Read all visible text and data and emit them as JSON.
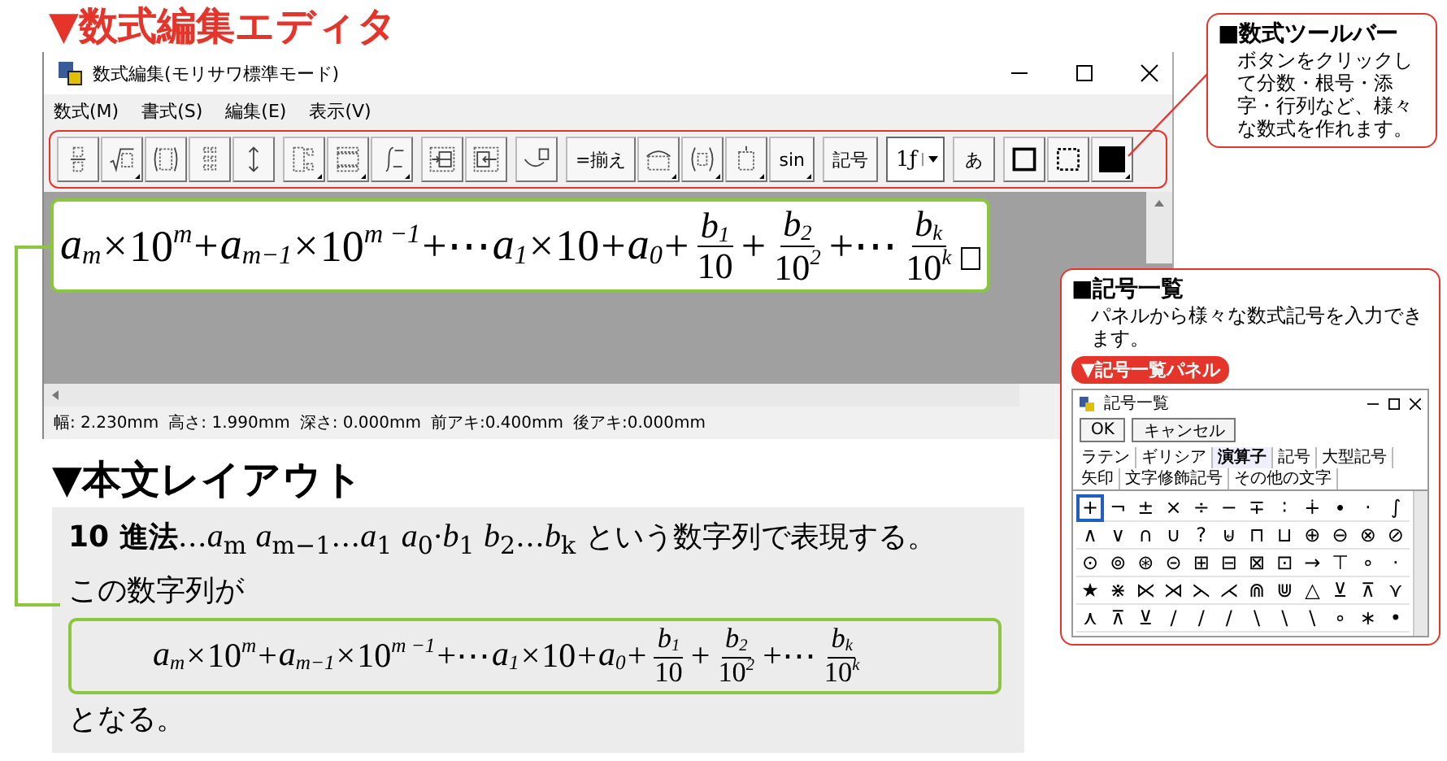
{
  "heading": "▼数式編集エディタ",
  "window": {
    "title": "数式編集(モリサワ標準モード)",
    "menu": [
      "数式(M)",
      "書式(S)",
      "編集(E)",
      "表示(V)"
    ],
    "toolbar": [
      [
        {
          "kind": "icon",
          "menu": false
        },
        {
          "kind": "icon",
          "menu": true
        },
        {
          "kind": "icon",
          "menu": false
        },
        {
          "kind": "icon",
          "menu": false
        },
        {
          "kind": "icon",
          "menu": false
        }
      ],
      [
        {
          "kind": "icon",
          "menu": true
        },
        {
          "kind": "icon",
          "menu": true
        },
        {
          "kind": "icon",
          "menu": true
        }
      ],
      [
        {
          "kind": "icon",
          "menu": false
        },
        {
          "kind": "icon",
          "menu": false
        }
      ],
      [
        {
          "kind": "icon",
          "menu": false
        }
      ],
      [
        {
          "kind": "label",
          "text": "=揃え",
          "menu": false
        },
        {
          "kind": "icon",
          "menu": true
        },
        {
          "kind": "icon",
          "menu": true
        },
        {
          "kind": "icon",
          "menu": true
        },
        {
          "kind": "label",
          "text": "sin",
          "menu": true
        }
      ],
      [
        {
          "kind": "label",
          "text": "記号",
          "menu": false
        }
      ],
      [
        {
          "kind": "dropdown",
          "text": "1ƒ"
        }
      ],
      [
        {
          "kind": "label",
          "text": "あ",
          "menu": false
        }
      ],
      [
        {
          "kind": "icon",
          "menu": false
        },
        {
          "kind": "icon",
          "menu": false
        },
        {
          "kind": "swatch",
          "menu": true
        }
      ]
    ],
    "formula": [
      {
        "kind": "var",
        "base": "a",
        "sub": "m"
      },
      {
        "kind": "op",
        "text": "×"
      },
      {
        "kind": "num",
        "base": "10",
        "sup": "m"
      },
      {
        "kind": "op",
        "text": "+"
      },
      {
        "kind": "var",
        "base": "a",
        "sub": "m−1"
      },
      {
        "kind": "op",
        "text": "×"
      },
      {
        "kind": "num",
        "base": "10",
        "sup": "m −1"
      },
      {
        "kind": "op",
        "text": "+⋯"
      },
      {
        "kind": "var",
        "base": "a",
        "sub": "1"
      },
      {
        "kind": "op",
        "text": "×"
      },
      {
        "kind": "num",
        "base": "10"
      },
      {
        "kind": "op",
        "text": "+"
      },
      {
        "kind": "var",
        "base": "a",
        "sub": "0"
      },
      {
        "kind": "op",
        "text": "+"
      },
      {
        "kind": "frac",
        "num": {
          "kind": "var",
          "base": "b",
          "sub": "1"
        },
        "den": {
          "kind": "num",
          "base": "10"
        }
      },
      {
        "kind": "op",
        "text": "+"
      },
      {
        "kind": "frac",
        "num": {
          "kind": "var",
          "base": "b",
          "sub": "2"
        },
        "den": {
          "kind": "num",
          "base": "10",
          "sup": "2"
        }
      },
      {
        "kind": "op",
        "text": "+⋯"
      },
      {
        "kind": "frac",
        "num": {
          "kind": "var",
          "base": "b",
          "sub": "k"
        },
        "den": {
          "kind": "num",
          "base": "10",
          "sup": "k"
        }
      }
    ],
    "status_bar": [
      "幅: 2.230mm",
      "高さ: 1.990mm",
      "深さ: 0.000mm",
      "前アキ:0.400mm",
      "後アキ:0.000mm"
    ]
  },
  "toolbar_note": {
    "title": "■数式ツールバー",
    "text": "ボタンをクリックして分数・根号・添字・行列など、様々な数式を作れます。"
  },
  "symbol_note": {
    "title": "■記号一覧",
    "text": "パネルから様々な数式記号を入力できます。",
    "badge": "▼記号一覧パネル",
    "panel": {
      "title": "記号一覧",
      "buttons": [
        "OK",
        "キャンセル"
      ],
      "tabs": [
        {
          "label": "ラテン",
          "selected": false
        },
        {
          "label": "ギリシア",
          "selected": false
        },
        {
          "label": "演算子",
          "selected": true
        },
        {
          "label": "記号",
          "selected": false
        },
        {
          "label": "大型記号",
          "selected": false
        },
        {
          "label": "矢印",
          "selected": false
        },
        {
          "label": "文字修飾記号",
          "selected": false
        },
        {
          "label": "その他の文字",
          "selected": false
        }
      ],
      "symbols": [
        {
          "text": "+",
          "selected": true
        },
        {
          "text": "¬",
          "selected": false
        },
        {
          "text": "±",
          "selected": false
        },
        {
          "text": "×",
          "selected": false
        },
        {
          "text": "÷",
          "selected": false
        },
        {
          "text": "−",
          "selected": false
        },
        {
          "text": "∓",
          "selected": false
        },
        {
          "text": "∶",
          "selected": false
        },
        {
          "text": "∔",
          "selected": false
        },
        {
          "text": "∙",
          "selected": false
        },
        {
          "text": "·",
          "selected": false
        },
        {
          "text": "∫",
          "selected": false
        },
        {
          "text": "∧",
          "selected": false
        },
        {
          "text": "∨",
          "selected": false
        },
        {
          "text": "∩",
          "selected": false
        },
        {
          "text": "∪",
          "selected": false
        },
        {
          "text": "?",
          "selected": false
        },
        {
          "text": "⊌",
          "selected": false
        },
        {
          "text": "⊓",
          "selected": false
        },
        {
          "text": "⊔",
          "selected": false
        },
        {
          "text": "⊕",
          "selected": false
        },
        {
          "text": "⊖",
          "selected": false
        },
        {
          "text": "⊗",
          "selected": false
        },
        {
          "text": "⊘",
          "selected": false
        },
        {
          "text": "⊙",
          "selected": false
        },
        {
          "text": "⊚",
          "selected": false
        },
        {
          "text": "⊛",
          "selected": false
        },
        {
          "text": "⊝",
          "selected": false
        },
        {
          "text": "⊞",
          "selected": false
        },
        {
          "text": "⊟",
          "selected": false
        },
        {
          "text": "⊠",
          "selected": false
        },
        {
          "text": "⊡",
          "selected": false
        },
        {
          "text": "→",
          "selected": false
        },
        {
          "text": "⊤",
          "selected": false
        },
        {
          "text": "∘",
          "selected": false
        },
        {
          "text": "·",
          "selected": false
        },
        {
          "text": "★",
          "selected": false
        },
        {
          "text": "⋇",
          "selected": false
        },
        {
          "text": "⋉",
          "selected": false
        },
        {
          "text": "⋊",
          "selected": false
        },
        {
          "text": "⋋",
          "selected": false
        },
        {
          "text": "⋌",
          "selected": false
        },
        {
          "text": "⋒",
          "selected": false
        },
        {
          "text": "⋓",
          "selected": false
        },
        {
          "text": "△",
          "selected": false
        },
        {
          "text": "⊻",
          "selected": false
        },
        {
          "text": "⊼",
          "selected": false
        },
        {
          "text": "⋎",
          "selected": false
        },
        {
          "text": "⋏",
          "selected": false
        },
        {
          "text": "⊼",
          "selected": false
        },
        {
          "text": "⊻",
          "selected": false
        },
        {
          "text": "/",
          "selected": false
        },
        {
          "text": "/",
          "selected": false
        },
        {
          "text": "/",
          "selected": false
        },
        {
          "text": "\\",
          "selected": false
        },
        {
          "text": "\\",
          "selected": false
        },
        {
          "text": "\\",
          "selected": false
        },
        {
          "text": "∘",
          "selected": false
        },
        {
          "text": "∗",
          "selected": false
        },
        {
          "text": "•",
          "selected": false
        }
      ]
    }
  },
  "layout_heading": "▼本文レイアウト",
  "body": {
    "lines": [
      "**10 進法**…*a*$_{m}$ *a*$_{m−1}$…*a*$_{1}$ *a*$_{0}$·*b*$_{1}$ *b*$_{2}$…*b*$_{k}$ という数字列で表現する。",
      "この数字列が"
    ],
    "formula": [
      {
        "kind": "var",
        "base": "a",
        "sub": "m"
      },
      {
        "kind": "op",
        "text": "×"
      },
      {
        "kind": "num",
        "base": "10",
        "sup": "m"
      },
      {
        "kind": "op",
        "text": "+"
      },
      {
        "kind": "var",
        "base": "a",
        "sub": "m−1"
      },
      {
        "kind": "op",
        "text": "×"
      },
      {
        "kind": "num",
        "base": "10",
        "sup": "m −1"
      },
      {
        "kind": "op",
        "text": "+⋯"
      },
      {
        "kind": "var",
        "base": "a",
        "sub": "1"
      },
      {
        "kind": "op",
        "text": "×"
      },
      {
        "kind": "num",
        "base": "10"
      },
      {
        "kind": "op",
        "text": "+"
      },
      {
        "kind": "var",
        "base": "a",
        "sub": "0"
      },
      {
        "kind": "op",
        "text": "+"
      },
      {
        "kind": "frac",
        "num": {
          "kind": "var",
          "base": "b",
          "sub": "1"
        },
        "den": {
          "kind": "num",
          "base": "10"
        }
      },
      {
        "kind": "op",
        "text": "+"
      },
      {
        "kind": "frac",
        "num": {
          "kind": "var",
          "base": "b",
          "sub": "2"
        },
        "den": {
          "kind": "num",
          "base": "10",
          "sup": "2"
        }
      },
      {
        "kind": "op",
        "text": "+⋯"
      },
      {
        "kind": "frac",
        "num": {
          "kind": "var",
          "base": "b",
          "sub": "k"
        },
        "den": {
          "kind": "num",
          "base": "10",
          "sup": "k"
        }
      }
    ],
    "closing": "となる。"
  }
}
